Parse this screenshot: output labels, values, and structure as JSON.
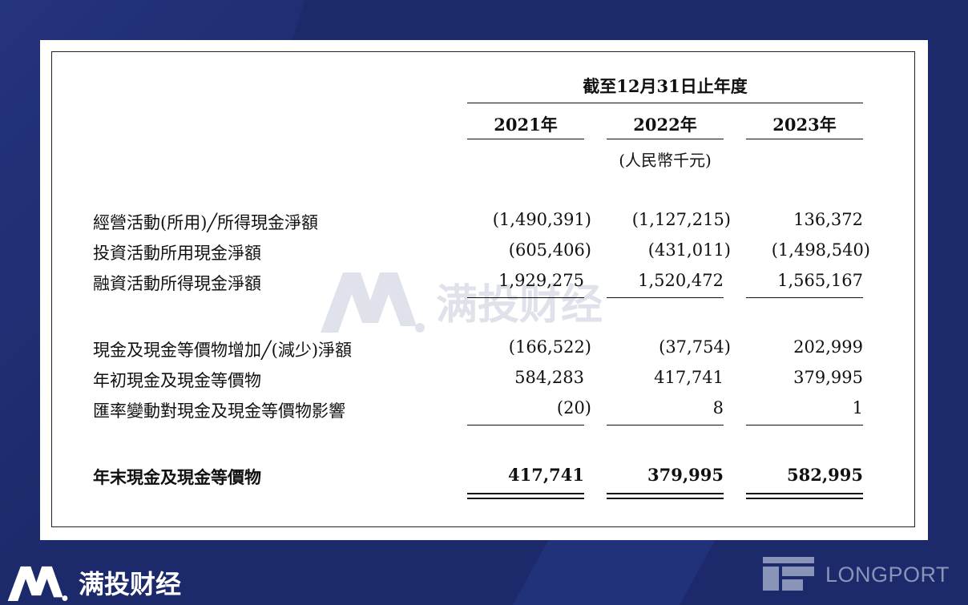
{
  "header": {
    "period": "截至12月31日止年度",
    "years": [
      "2021年",
      "2022年",
      "2023年"
    ],
    "unit": "(人民幣千元)"
  },
  "rows": [
    {
      "label": "經營活動(所用)╱所得現金淨額",
      "values": [
        "(1,490,391)",
        "(1,127,215)",
        "136,372"
      ]
    },
    {
      "label": "投資活動所用現金淨額",
      "values": [
        "(605,406)",
        "(431,011)",
        "(1,498,540)"
      ]
    },
    {
      "label": "融資活動所得現金淨額",
      "values": [
        "1,929,275",
        "1,520,472",
        "1,565,167"
      ]
    },
    {
      "label": "現金及現金等價物增加╱(減少)淨額",
      "values": [
        "(166,522)",
        "(37,754)",
        "202,999"
      ]
    },
    {
      "label": "年初現金及現金等價物",
      "values": [
        "584,283",
        "417,741",
        "379,995"
      ]
    },
    {
      "label": "匯率變動對現金及現金等價物影響",
      "values": [
        "(20)",
        "8",
        "1"
      ]
    },
    {
      "label": "年末現金及現金等價物",
      "values": [
        "417,741",
        "379,995",
        "582,995"
      ]
    }
  ],
  "watermark": {
    "text": "满投财经"
  },
  "brand": {
    "name": "满投财经"
  },
  "partner": {
    "name": "LONGPORT"
  },
  "colors": {
    "background": "#1c2a6b",
    "paper": "#ffffff",
    "text": "#111111"
  }
}
